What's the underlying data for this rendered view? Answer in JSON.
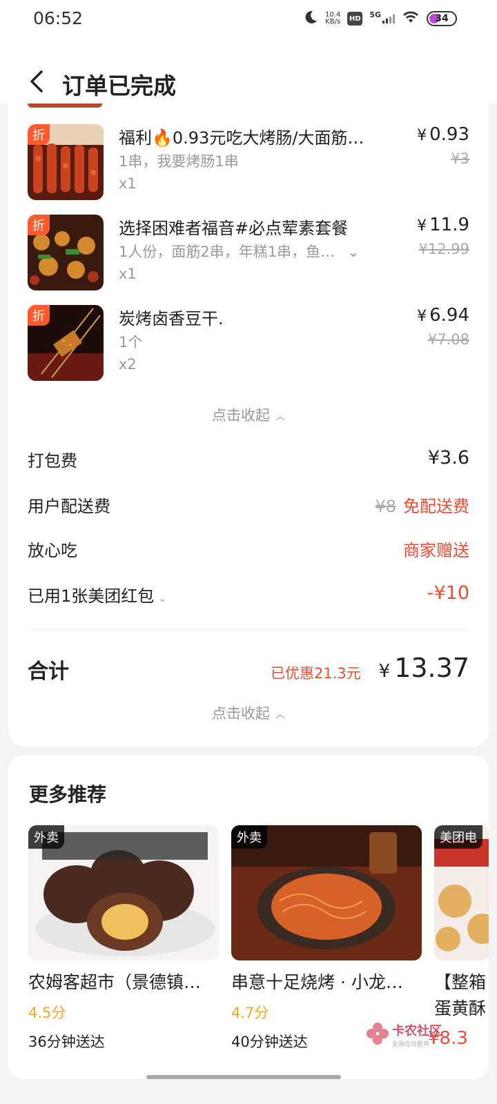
{
  "status_bar": {
    "time": "06:52",
    "speed_value": "10.4",
    "speed_unit": "KB/s",
    "hd": "HD",
    "network": "5G",
    "battery": "34",
    "icons": [
      "moon-icon",
      "wifi-icon",
      "signal-icon",
      "battery-icon"
    ]
  },
  "header": {
    "title": "订单已完成",
    "back_icon": "chevron-left-icon"
  },
  "items": [
    {
      "discount_tag": "折",
      "name": "福利🔥0.93元吃大烤肠/大面筋…",
      "spec": "1串，我要烤肠1串",
      "qty": "x1",
      "price": "0.93",
      "orig_price": "¥3",
      "image": "grilled-sausage-skewers"
    },
    {
      "discount_tag": "折",
      "name": "选择困难者福音#必点荤素套餐",
      "spec": "1人份，面筋2串，年糕1串，鱼…",
      "qty": "x1",
      "price": "11.9",
      "orig_price": "¥12.99",
      "image": "mixed-bbq-set"
    },
    {
      "discount_tag": "折",
      "name": "炭烤卤香豆干.",
      "spec": "1个",
      "qty": "x2",
      "price": "6.94",
      "orig_price": "¥7.08",
      "image": "grilled-tofu-skewer"
    }
  ],
  "currency": "¥",
  "collapse_label": "点击收起",
  "fees": {
    "packing_label": "打包费",
    "packing_value": "¥3.6",
    "delivery_label": "用户配送费",
    "delivery_orig": "¥8",
    "delivery_value": "免配送费",
    "assurance_label": "放心吃",
    "assurance_value": "商家赠送",
    "coupon_label": "已用1张美团红包",
    "coupon_value": "-¥10"
  },
  "total": {
    "label": "合计",
    "saved": "已优惠21.3元",
    "amount": "13.37"
  },
  "recommend": {
    "title": "更多推荐",
    "items": [
      {
        "tag": "外卖",
        "name": "农姆客超市（景德镇…",
        "score": "4.5分",
        "time": "36分钟送达",
        "image": "marinated-eggs"
      },
      {
        "tag": "外卖",
        "name": "串意十足烧烤 · 小龙…",
        "score": "4.7分",
        "time": "40分钟送达",
        "image": "spicy-noodles"
      },
      {
        "tag": "美团电",
        "name": "【整箱",
        "name2": "蛋黄酥",
        "price": "¥8.3",
        "image": "egg-yolk-pastry"
      }
    ]
  },
  "watermark": {
    "text": "卡农社区",
    "sub": "金融在线教育"
  },
  "colors": {
    "accent": "#f04a30",
    "score": "#f5a623",
    "discount_tag": "#ff5a2c"
  }
}
